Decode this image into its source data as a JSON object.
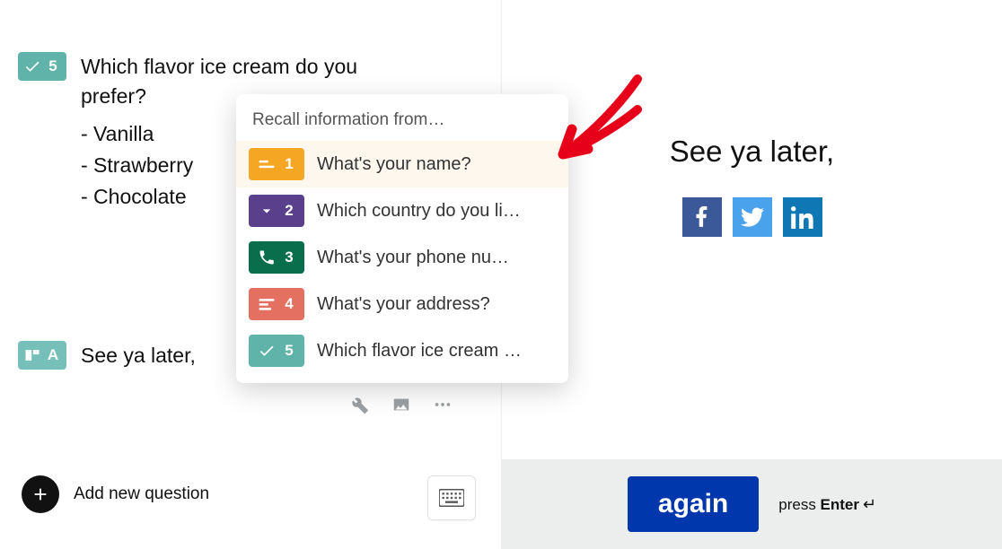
{
  "left": {
    "q5": {
      "number": "5",
      "title": "Which flavor ice cream do you prefer?",
      "options": [
        "-  Vanilla",
        "-  Strawberry",
        "-  Chocolate"
      ]
    },
    "qA": {
      "number": "A",
      "title": "See ya later,"
    },
    "add_label": "Add new question"
  },
  "recall": {
    "title": "Recall information from…",
    "items": [
      {
        "num": "1",
        "label": "What's your name?",
        "color": "orange",
        "icon": "short-text",
        "highlight": true
      },
      {
        "num": "2",
        "label": "Which country do you li…",
        "color": "purple",
        "icon": "chevron-down"
      },
      {
        "num": "3",
        "label": "What's your phone nu…",
        "color": "green",
        "icon": "phone"
      },
      {
        "num": "4",
        "label": "What's your address?",
        "color": "coral",
        "icon": "long-text"
      },
      {
        "num": "5",
        "label": "Which flavor ice cream …",
        "color": "teal",
        "icon": "check"
      }
    ]
  },
  "preview": {
    "text": "See ya later,",
    "button": "again",
    "hint_prefix": "press ",
    "hint_key": "Enter"
  }
}
